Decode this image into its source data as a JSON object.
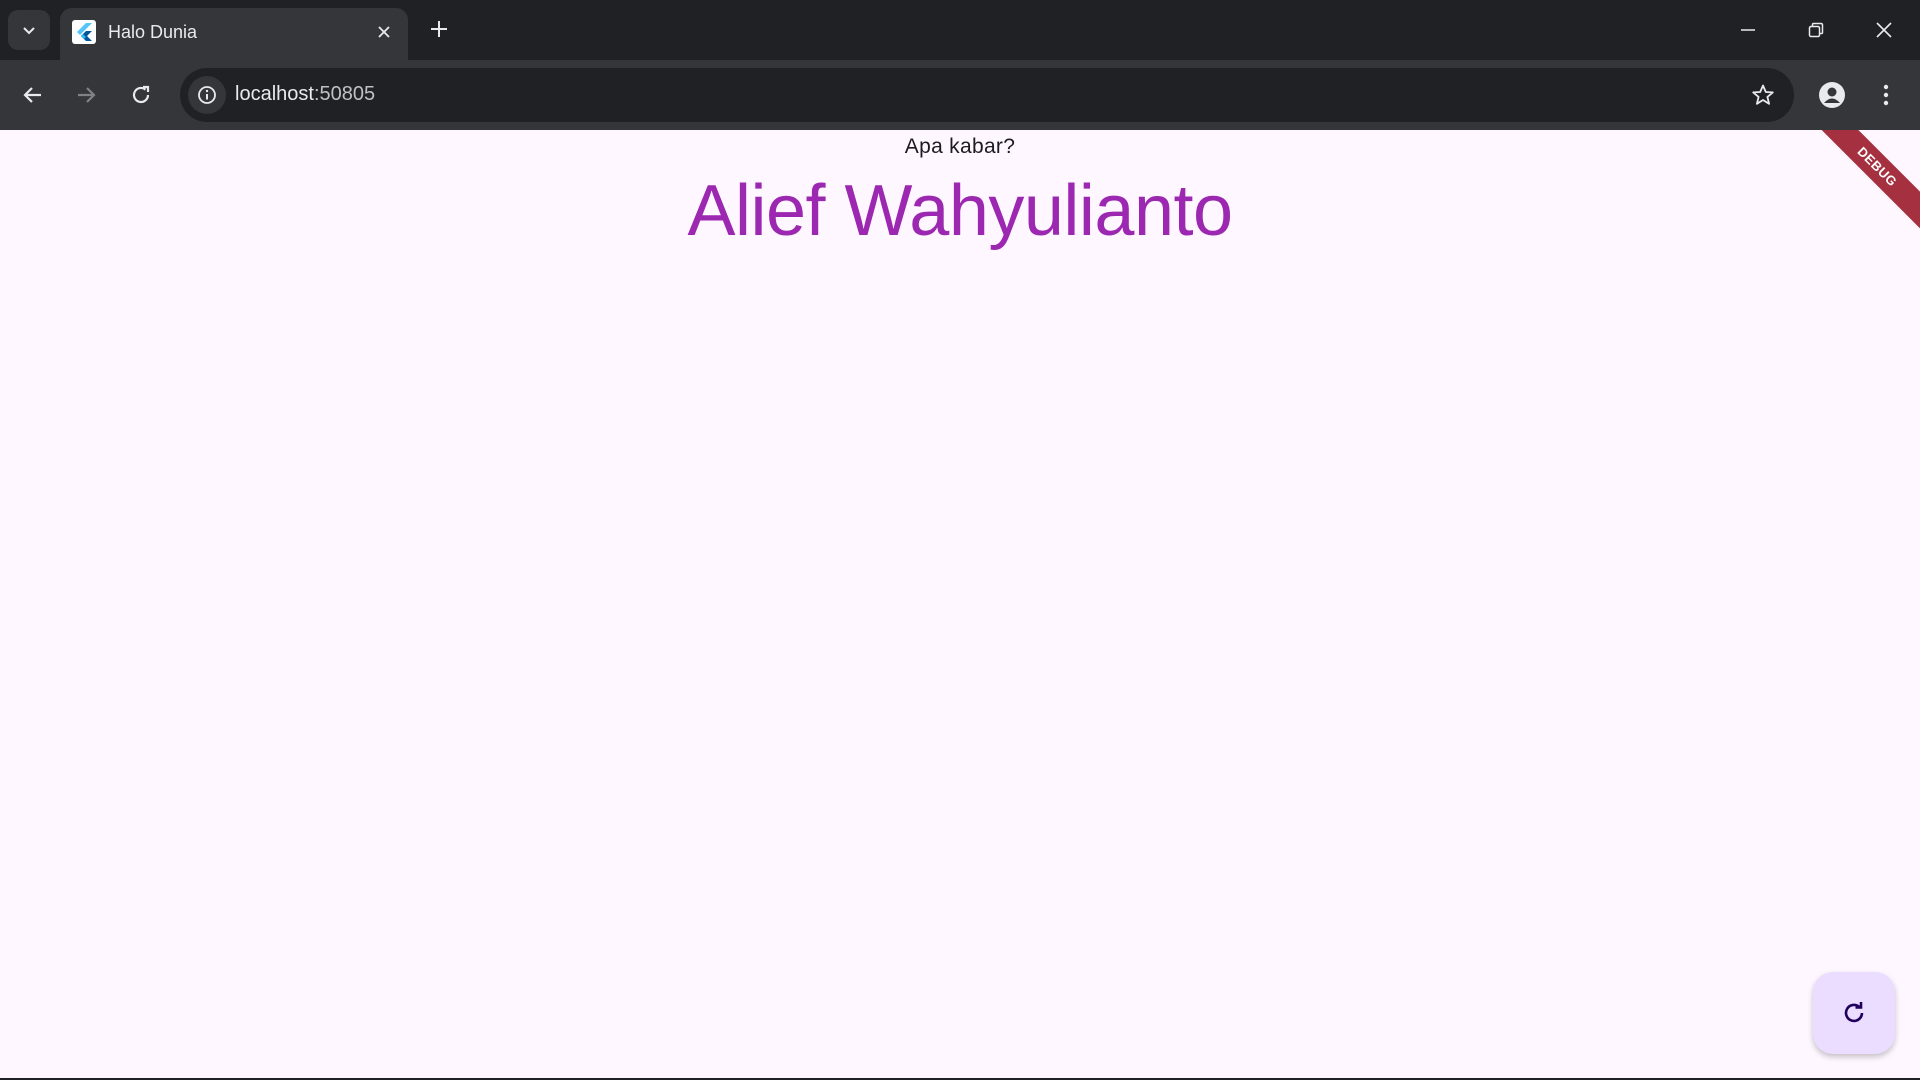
{
  "browser": {
    "tab": {
      "title": "Halo Dunia"
    },
    "address_bar": {
      "host": "localhost",
      "port": ":50805"
    }
  },
  "page": {
    "greeting": "Apa kabar?",
    "name": "Alief Wahyulianto",
    "debug_banner": "DEBUG",
    "fab_icon": "refresh-icon"
  },
  "colors": {
    "page_background": "#fef7ff",
    "name_color": "#9c27b0",
    "fab_background": "#eaddff",
    "debug_banner": "#a5303f",
    "browser_frame": "#202124",
    "browser_toolbar": "#35363a"
  }
}
